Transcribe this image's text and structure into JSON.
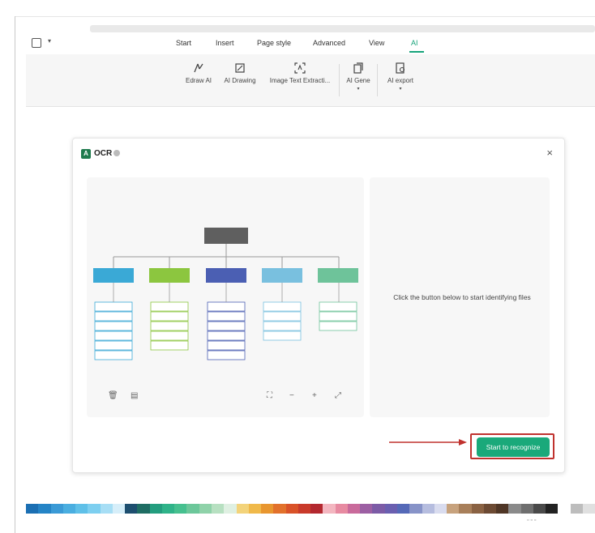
{
  "menu": {
    "tabs": [
      {
        "label": "Start"
      },
      {
        "label": "Insert"
      },
      {
        "label": "Page style"
      },
      {
        "label": "Advanced"
      },
      {
        "label": "View"
      },
      {
        "label": "AI"
      }
    ],
    "active_tab": "AI"
  },
  "ribbon": {
    "buttons": [
      {
        "label": "Edraw AI",
        "icon": "edraw-ai-icon"
      },
      {
        "label": "AI Drawing",
        "icon": "ai-drawing-icon"
      },
      {
        "label": "Image Text Extracti...",
        "icon": "image-text-extraction-icon"
      },
      {
        "label": "AI Gene",
        "icon": "ai-generate-icon"
      },
      {
        "label": "AI export",
        "icon": "ai-export-icon"
      }
    ]
  },
  "dialog": {
    "title": "OCR",
    "hint": "Click the button below to start identifying files",
    "start_button": "Start to recognize",
    "close_icon": "close-icon"
  },
  "colors": {
    "accent": "#1aa97a",
    "highlight": "#c0322e",
    "chart_root": "#5f5f5f",
    "chart_branches": [
      "#3aa9d6",
      "#8cc63f",
      "#4b5fb3",
      "#79c0df",
      "#6ec39a"
    ]
  },
  "palette": [
    "#1b6fb3",
    "#2584c6",
    "#3a9ad6",
    "#4aaee0",
    "#5fc0e8",
    "#7dcff0",
    "#a7def5",
    "#d6eef9",
    "#1d4e6f",
    "#1f6d63",
    "#239d7e",
    "#2fb389",
    "#46c08f",
    "#6cc79a",
    "#8fd2a9",
    "#b7e0c1",
    "#dff0e2",
    "#f3d37a",
    "#f0b94a",
    "#e8962f",
    "#e2712b",
    "#d95228",
    "#c93a2a",
    "#b3282f",
    "#f3b6c0",
    "#e78aa1",
    "#c96a9b",
    "#9c5fa3",
    "#7c5ba6",
    "#6a5fb0",
    "#5569b8",
    "#8793c8",
    "#b6bddf",
    "#d9dcef",
    "#c7a27d",
    "#a87f5a",
    "#8a6243",
    "#6c4a33",
    "#4f3626",
    "#8a8a8a",
    "#6f6f6f",
    "#4a4a4a",
    "#222222",
    "#ffffff",
    "#bdbdbd",
    "#e0e0e0"
  ]
}
